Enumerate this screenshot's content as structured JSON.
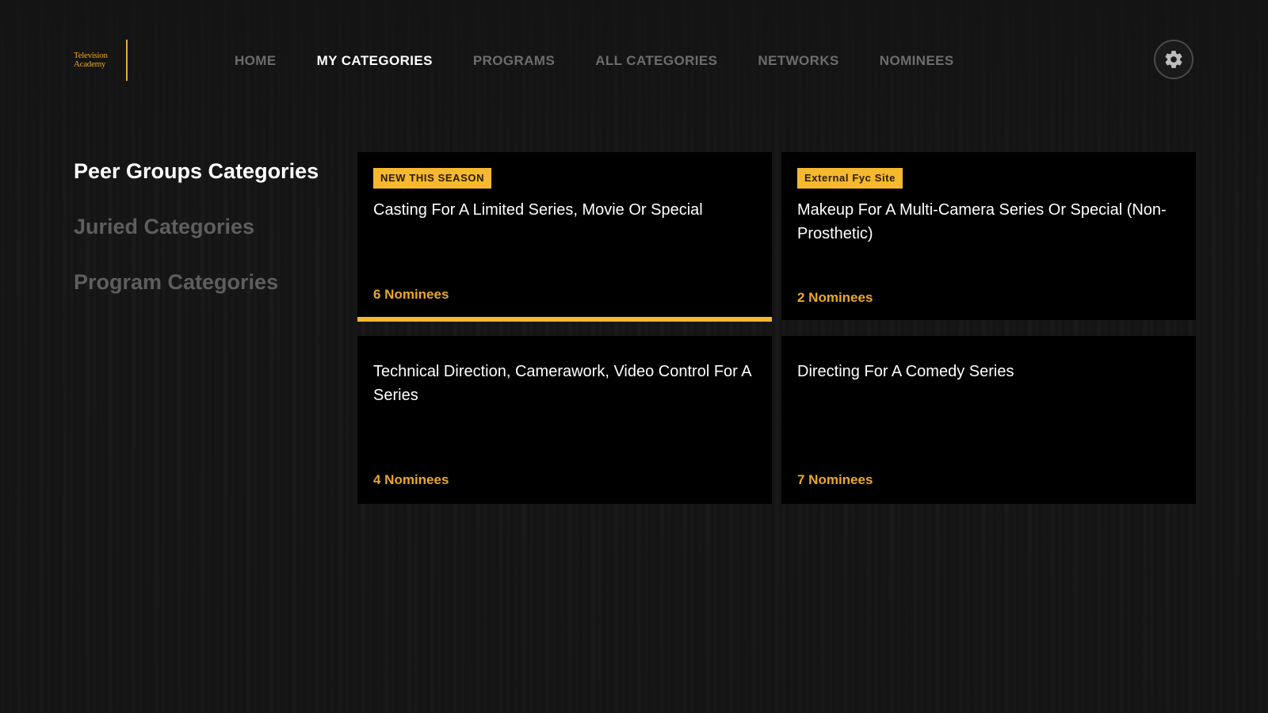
{
  "logo": {
    "line1": "Television",
    "line2": "Academy"
  },
  "nav": {
    "items": [
      {
        "label": "HOME",
        "active": false
      },
      {
        "label": "MY CATEGORIES",
        "active": true
      },
      {
        "label": "PROGRAMS",
        "active": false
      },
      {
        "label": "ALL CATEGORIES",
        "active": false
      },
      {
        "label": "NETWORKS",
        "active": false
      },
      {
        "label": "NOMINEES",
        "active": false
      }
    ],
    "settings_icon": "gear-icon"
  },
  "sidebar": {
    "items": [
      {
        "label": "Peer Groups Categories",
        "active": true
      },
      {
        "label": "Juried Categories",
        "active": false
      },
      {
        "label": "Program Categories",
        "active": false
      }
    ]
  },
  "cards": [
    {
      "badge": "NEW THIS SEASON",
      "title": "Casting For A Limited Series, Movie Or Special",
      "nominees": "6 Nominees",
      "focused": true
    },
    {
      "badge": "External Fyc Site",
      "title": "Makeup For A Multi-Camera Series Or Special (Non-Prosthetic)",
      "nominees": "2 Nominees",
      "focused": false
    },
    {
      "badge": "",
      "title": "Technical Direction, Camerawork, Video Control For A Series",
      "nominees": "4 Nominees",
      "focused": false
    },
    {
      "badge": "",
      "title": "Directing For A Comedy Series",
      "nominees": "7 Nominees",
      "focused": false
    }
  ],
  "colors": {
    "accent": "#f5b82e",
    "background": "#141414",
    "card": "#000000",
    "inactive_text": "#6d6d6d"
  }
}
